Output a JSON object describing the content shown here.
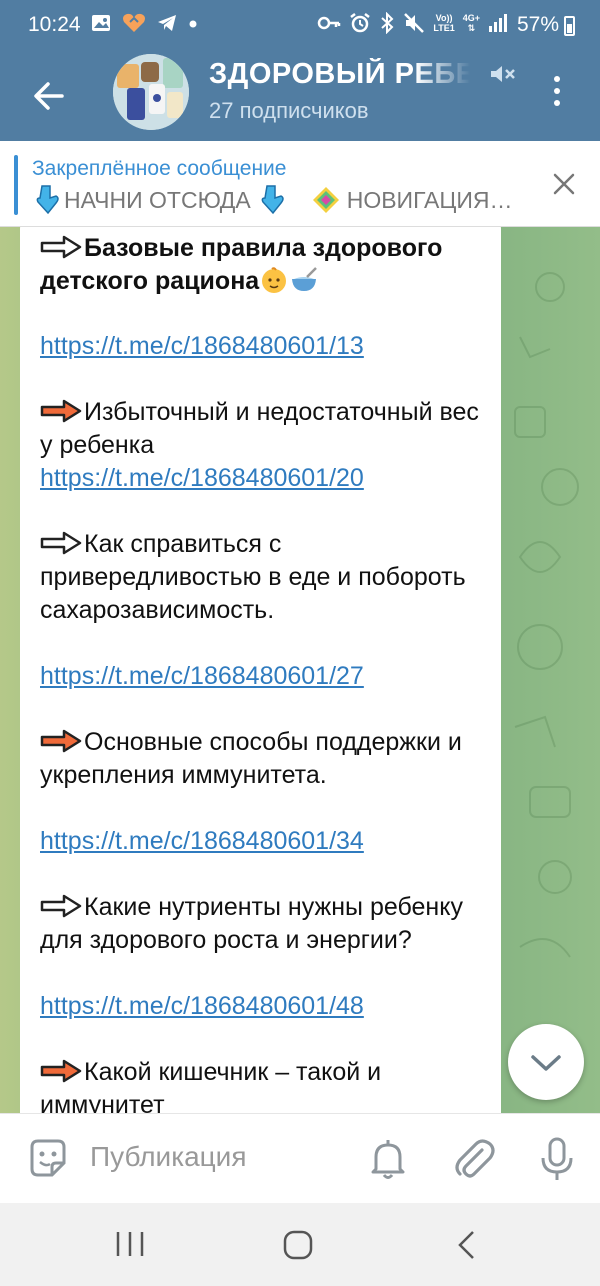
{
  "status_bar": {
    "time": "10:24",
    "battery": "57%",
    "network_top": "Vo))",
    "network_bottom": "LTE1",
    "data_top": "4G+",
    "icons": [
      "gallery-icon",
      "heart-app-icon",
      "telegram-icon",
      "dot-icon",
      "key-icon",
      "alarm-icon",
      "bluetooth-icon",
      "mute-icon",
      "signal-icon",
      "battery-icon"
    ]
  },
  "header": {
    "title": "ЗДОРОВЫЙ РЕБЕНОК",
    "subscribers": "27 подписчиков",
    "back_icon": "arrow-left-icon",
    "more_icon": "more-vertical-icon",
    "mute_icon": "muted-speaker-icon"
  },
  "pinned": {
    "title": "Закреплённое сообщение",
    "text": "НАЧНИ ОТСЮДА",
    "text2": "НОВИГАЦИЯ…"
  },
  "message": {
    "items": [
      {
        "text": "Базовые правила здорового детского рациона",
        "link": "https://t.me/c/1868480601/13"
      },
      {
        "text": "Избыточный и недостаточный вес у ребенка",
        "link": "https://t.me/c/1868480601/20"
      },
      {
        "text": "Как справиться с привередливостью в еде и побороть сахарозависимость.",
        "link": "https://t.me/c/1868480601/27"
      },
      {
        "text": "Основные способы поддержки и укрепления иммунитета.",
        "link": "https://t.me/c/1868480601/34"
      },
      {
        "text": "Какие нутриенты нужны ребенку для здорового роста и энергии?",
        "link": "https://t.me/c/1868480601/48"
      },
      {
        "text": "Какой кишечник – такой и иммунитет",
        "link": ""
      }
    ]
  },
  "input": {
    "placeholder": "Публикация"
  },
  "colors": {
    "header": "#517da2",
    "link": "#2f7bbf",
    "accent": "#3a8fd4",
    "arrow_orange": "#f06a3a"
  }
}
